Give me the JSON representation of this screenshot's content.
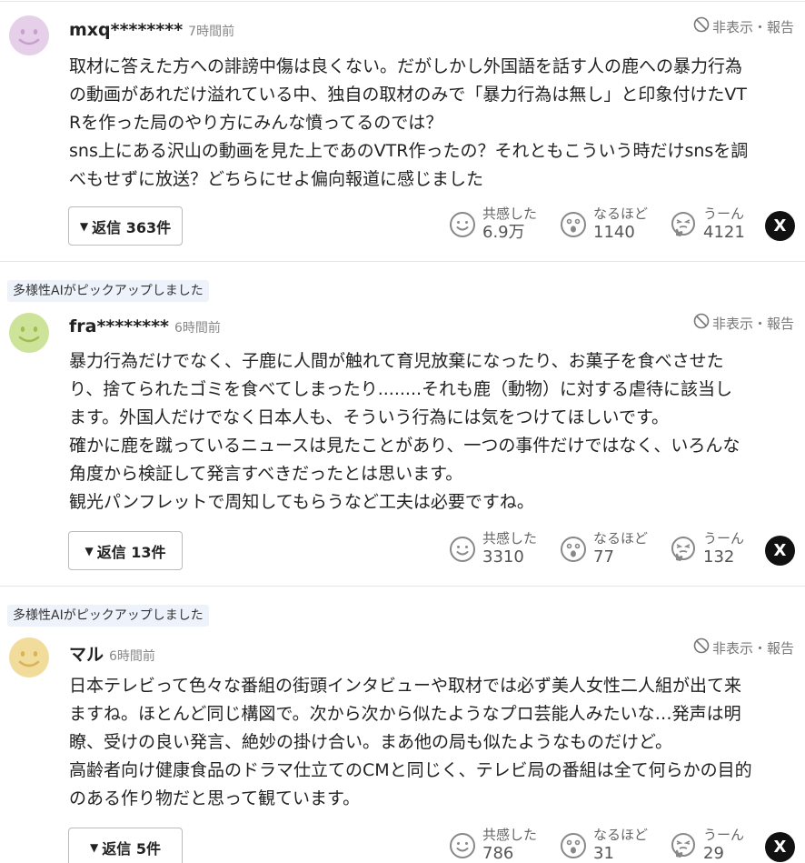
{
  "comments": [
    {
      "pick_label": "",
      "user": "mxq********",
      "time": "7時間前",
      "hide_report": "非表示・報告",
      "lines": [
        "取材に答えた方への誹謗中傷は良くない。だがしかし外国語を話す人の鹿への暴力行為",
        "の動画があれだけ溢れている中、独自の取材のみで「暴力行為は無し」と印象付けたVT",
        "Rを作った局のやり方にみんな憤ってるのでは？",
        "sns上にある沢山の動画を見た上であのVTR作ったの？それともこういう時だけsnsを調",
        "べもせずに放送？どちらにせよ偏向報道に感じました"
      ],
      "reply_label": "返信 363件",
      "reactions": [
        {
          "label": "共感した",
          "count": "6.9万",
          "icon": "smile-icon"
        },
        {
          "label": "なるほど",
          "count": "1140",
          "icon": "surprised-icon"
        },
        {
          "label": "うーん",
          "count": "4121",
          "icon": "thinking-icon"
        }
      ],
      "avatar_color": "#e6cfe8",
      "avatar_face": "#c8a0cf"
    },
    {
      "pick_label": "多様性AIがピックアップしました",
      "user": "fra********",
      "time": "6時間前",
      "hide_report": "非表示・報告",
      "lines": [
        "暴力行為だけでなく、子鹿に人間が触れて育児放棄になったり、お菓子を食べさせた",
        "り、捨てられたゴミを食べてしまったり........それも鹿（動物）に対する虐待に該当し",
        "ます。外国人だけでなく日本人も、そういう行為には気をつけてほしいです。",
        "確かに鹿を蹴っているニュースは見たことがあり、一つの事件だけではなく、いろんな",
        "角度から検証して発言すべきだったとは思います。",
        "観光パンフレットで周知してもらうなど工夫は必要ですね。"
      ],
      "reply_label": "返信 13件",
      "reactions": [
        {
          "label": "共感した",
          "count": "3310",
          "icon": "smile-icon"
        },
        {
          "label": "なるほど",
          "count": "77",
          "icon": "surprised-icon"
        },
        {
          "label": "うーん",
          "count": "132",
          "icon": "thinking-icon"
        }
      ],
      "avatar_color": "#cde39a",
      "avatar_face": "#9fbe52"
    },
    {
      "pick_label": "多様性AIがピックアップしました",
      "user": "マル",
      "time": "6時間前",
      "hide_report": "非表示・報告",
      "lines": [
        "日本テレビって色々な番組の街頭インタビューや取材では必ず美人女性二人組が出て来",
        "ますね。ほとんど同じ構図で。次から次から似たようなプロ芸能人みたいな…発声は明",
        "瞭、受けの良い発言、絶妙の掛け合い。まあ他の局も似たようなものだけど。",
        "高齢者向け健康食品のドラマ仕立てのCMと同じく、テレビ局の番組は全て何らかの目的",
        "のある作り物だと思って観ています。"
      ],
      "reply_label": "返信 5件",
      "reactions": [
        {
          "label": "共感した",
          "count": "786",
          "icon": "smile-icon"
        },
        {
          "label": "なるほど",
          "count": "31",
          "icon": "surprised-icon"
        },
        {
          "label": "うーん",
          "count": "29",
          "icon": "thinking-icon"
        }
      ],
      "avatar_color": "#f2dc9c",
      "avatar_face": "#d8b456"
    }
  ],
  "share_label": "X",
  "colors": {
    "icon_gray": "#888888",
    "x_button": "#111111"
  }
}
